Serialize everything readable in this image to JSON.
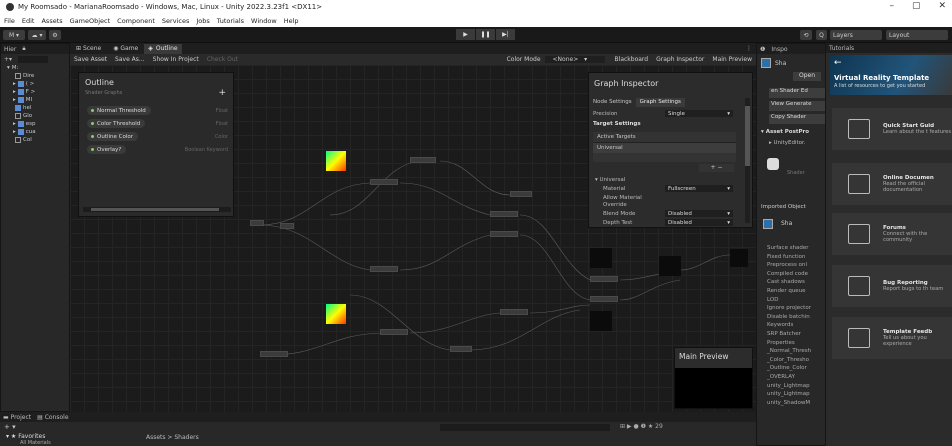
{
  "window": {
    "title": "My Roomsado - MarianaRoomsado - Windows, Mac, Linux - Unity 2022.3.23f1 <DX11>",
    "controls": [
      "–",
      "▢",
      "✕"
    ]
  },
  "menu": [
    "File",
    "Edit",
    "Assets",
    "GameObject",
    "Component",
    "Services",
    "Jobs",
    "Tutorials",
    "Window",
    "Help"
  ],
  "toolbar": {
    "account": "M ▾",
    "cloud": "☁ ▾",
    "settings": "⚙",
    "play": "▶",
    "pause": "❚❚",
    "step": "▶|",
    "history": "⟲",
    "search": "Q",
    "layers": "Layers",
    "layout": "Layout"
  },
  "hierarchy": {
    "tab": "Hier",
    "scene_root": "M:",
    "items": [
      "Dire",
      "( >",
      "F >",
      "MI",
      "hel",
      "Glo",
      "esp",
      "cua",
      "Col"
    ]
  },
  "shadergraph": {
    "tabs": [
      "Scene",
      "Game",
      "Outline"
    ],
    "bar_left": [
      "Save Asset",
      "Save As...",
      "Show In Project",
      "Check Out"
    ],
    "color_mode_label": "Color Mode",
    "color_mode_value": "<None>",
    "bar_right": [
      "Blackboard",
      "Graph Inspector",
      "Main Preview"
    ]
  },
  "blackboard": {
    "title": "Outline",
    "subtitle": "Shader Graphs",
    "add": "+",
    "properties": [
      {
        "name": "Normal Threshold",
        "type": "Float"
      },
      {
        "name": "Color Threshold",
        "type": "Float"
      },
      {
        "name": "Outline Color",
        "type": "Color"
      },
      {
        "name": "Overlay?",
        "type": "Boolean Keyword"
      }
    ]
  },
  "graph_inspector": {
    "title": "Graph Inspector",
    "tabs": [
      "Node Settings",
      "Graph Settings"
    ],
    "precision_label": "Precision",
    "precision_value": "Single",
    "target_settings": "Target Settings",
    "active_targets": "Active Targets",
    "target": "Universal",
    "plus_minus": "+  −",
    "universal": "Universal",
    "rows": [
      {
        "label": "Material",
        "value": "Fullscreen"
      },
      {
        "label": "Allow Material Override",
        "value": ""
      },
      {
        "label": "Blend Mode",
        "value": "Disabled"
      },
      {
        "label": "Depth Test",
        "value": "Disabled"
      }
    ]
  },
  "main_preview": {
    "title": "Main Preview"
  },
  "inspector": {
    "tab": "Inspo",
    "shader_label": "Sha",
    "open_button": "Open",
    "buttons": [
      "en Shader Ed",
      "View Generate",
      "Copy Shader"
    ],
    "asset_post": "Asset PostPro",
    "unity_editor": "UnityEditor.",
    "shader_sub": "Shader",
    "imported_object": "Imported Object",
    "shader_label2": "Sha",
    "list": [
      "Surface shader",
      "Fixed function",
      "Preprocess onl",
      "Compiled code",
      "Cast shadows",
      "Render queue",
      "LOD",
      "Ignore projector",
      "Disable batchin",
      "Keywords",
      "SRP Batcher",
      "Properties",
      "_Normal_Thresh",
      "_Color_Thresho",
      "_Outline_Color",
      "_OVERLAY",
      "unity_Lightmap",
      "unity_Lightmap",
      "unity_ShadowM"
    ]
  },
  "tutorials": {
    "tab": "Tutorials",
    "banner_title": "Virtual Reality Template",
    "banner_desc": "A list of resources to get you started",
    "cards": [
      {
        "title": "Quick Start Guid",
        "desc": "Learn about the t features"
      },
      {
        "title": "Online Documen",
        "desc": "Read the official documentation"
      },
      {
        "title": "Forums",
        "desc": "Connect with the community"
      },
      {
        "title": "Bug Reporting",
        "desc": "Report bugs to th team"
      },
      {
        "title": "Template Feedb",
        "desc": "Tell us about you experience"
      }
    ]
  },
  "project": {
    "tabs": [
      "Project",
      "Console"
    ],
    "favorites": "Favorites",
    "all_materials": "All Materials",
    "breadcrumb": "Assets > Shaders",
    "count": "29"
  }
}
